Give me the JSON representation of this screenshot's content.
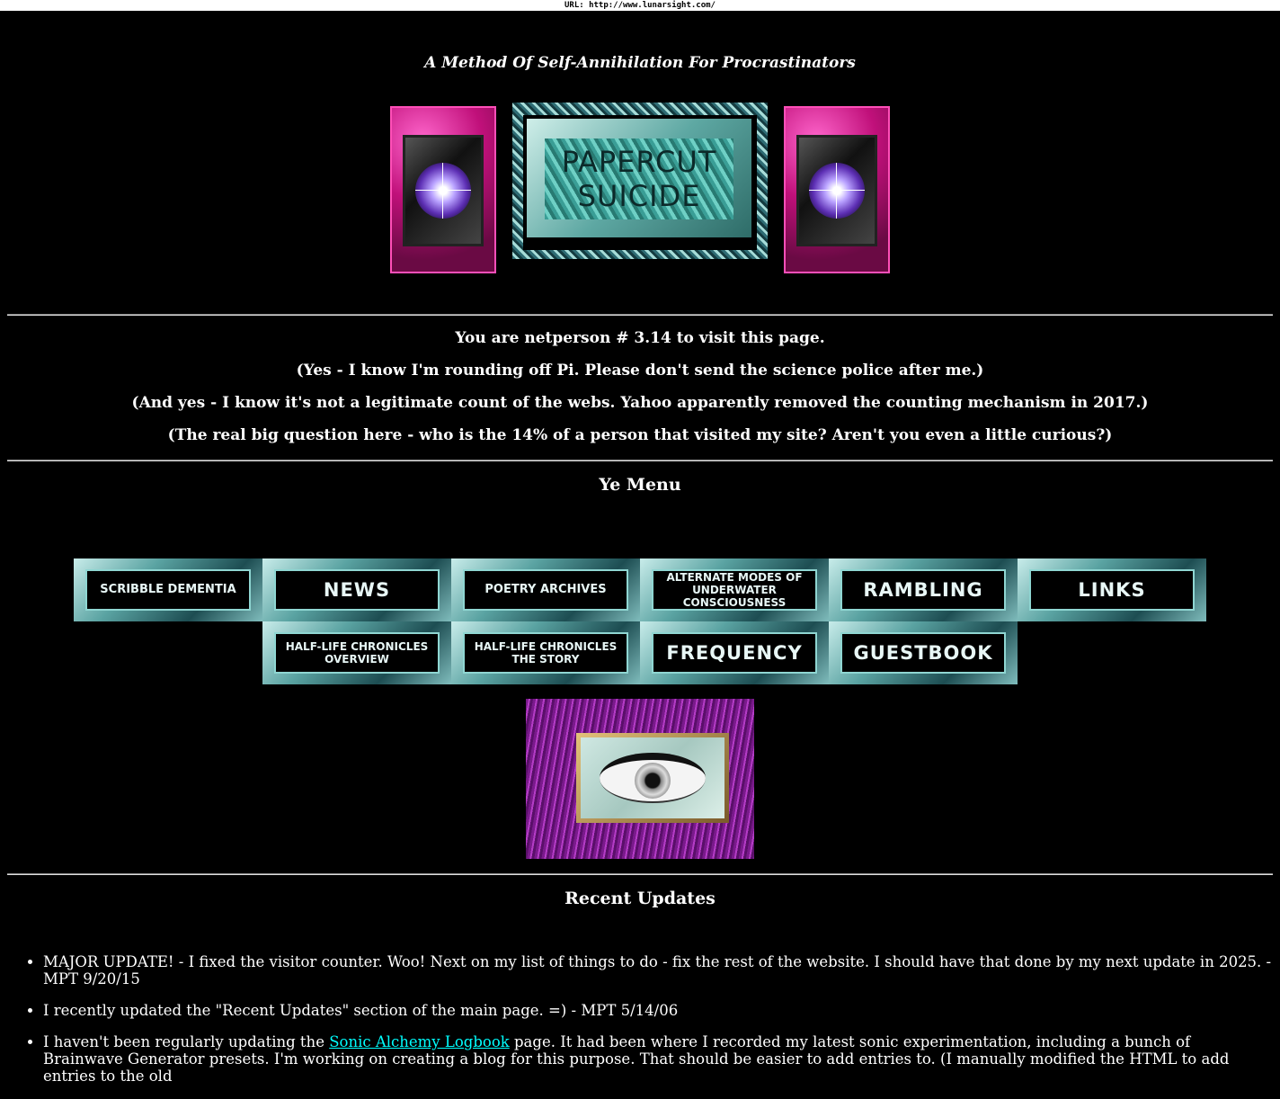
{
  "url_bar": "URL: http://www.lunarsight.com/",
  "tagline": "A Method Of Self-Annihilation For Procrastinators",
  "logo": {
    "line1": "PAPERCUT",
    "line2": "SUICIDE"
  },
  "counter": {
    "line1": "You are netperson # 3.14 to visit this page.",
    "line2": "(Yes - I know I'm rounding off Pi. Please don't send the science police after me.)",
    "line3": "(And yes - I know it's not a legitimate count of the webs. Yahoo apparently removed the counting mechanism in 2017.)",
    "line4": "(The real big question here - who is the 14% of a person that visited my site? Aren't you even a little curious?)"
  },
  "menu": {
    "title": "Ye Menu",
    "row1": [
      {
        "label": "SCRIBBLE DEMENTIA"
      },
      {
        "label": "NEWS"
      },
      {
        "label": "POETRY ARCHIVES"
      },
      {
        "label": "ALTERNATE MODES OF UNDERWATER CONSCIOUSNESS"
      },
      {
        "label": "RAMBLING"
      },
      {
        "label": "LINKS"
      }
    ],
    "row2": [
      {
        "label": "HALF-LIFE CHRONICLES OVERVIEW"
      },
      {
        "label": "HALF-LIFE CHRONICLES THE STORY"
      },
      {
        "label": "FREQUENCY"
      },
      {
        "label": "GUESTBOOK"
      }
    ]
  },
  "updates": {
    "title": "Recent Updates",
    "item1": "MAJOR UPDATE! - I fixed the visitor counter. Woo! Next on my list of things to do - fix the rest of the website. I should have that done by my next update in 2025. - MPT 9/20/15",
    "item2": "I recently updated the \"Recent Updates\" section of the main page. =) - MPT 5/14/06",
    "item3_pre": "I haven't been regularly updating the ",
    "item3_link": "Sonic Alchemy Logbook",
    "item3_post": " page. It had been where I recorded my latest sonic experimentation, including a bunch of Brainwave Generator presets. I'm working on creating a blog for this purpose. That should be easier to add entries to. (I manually modified the HTML to add entries to the old"
  }
}
